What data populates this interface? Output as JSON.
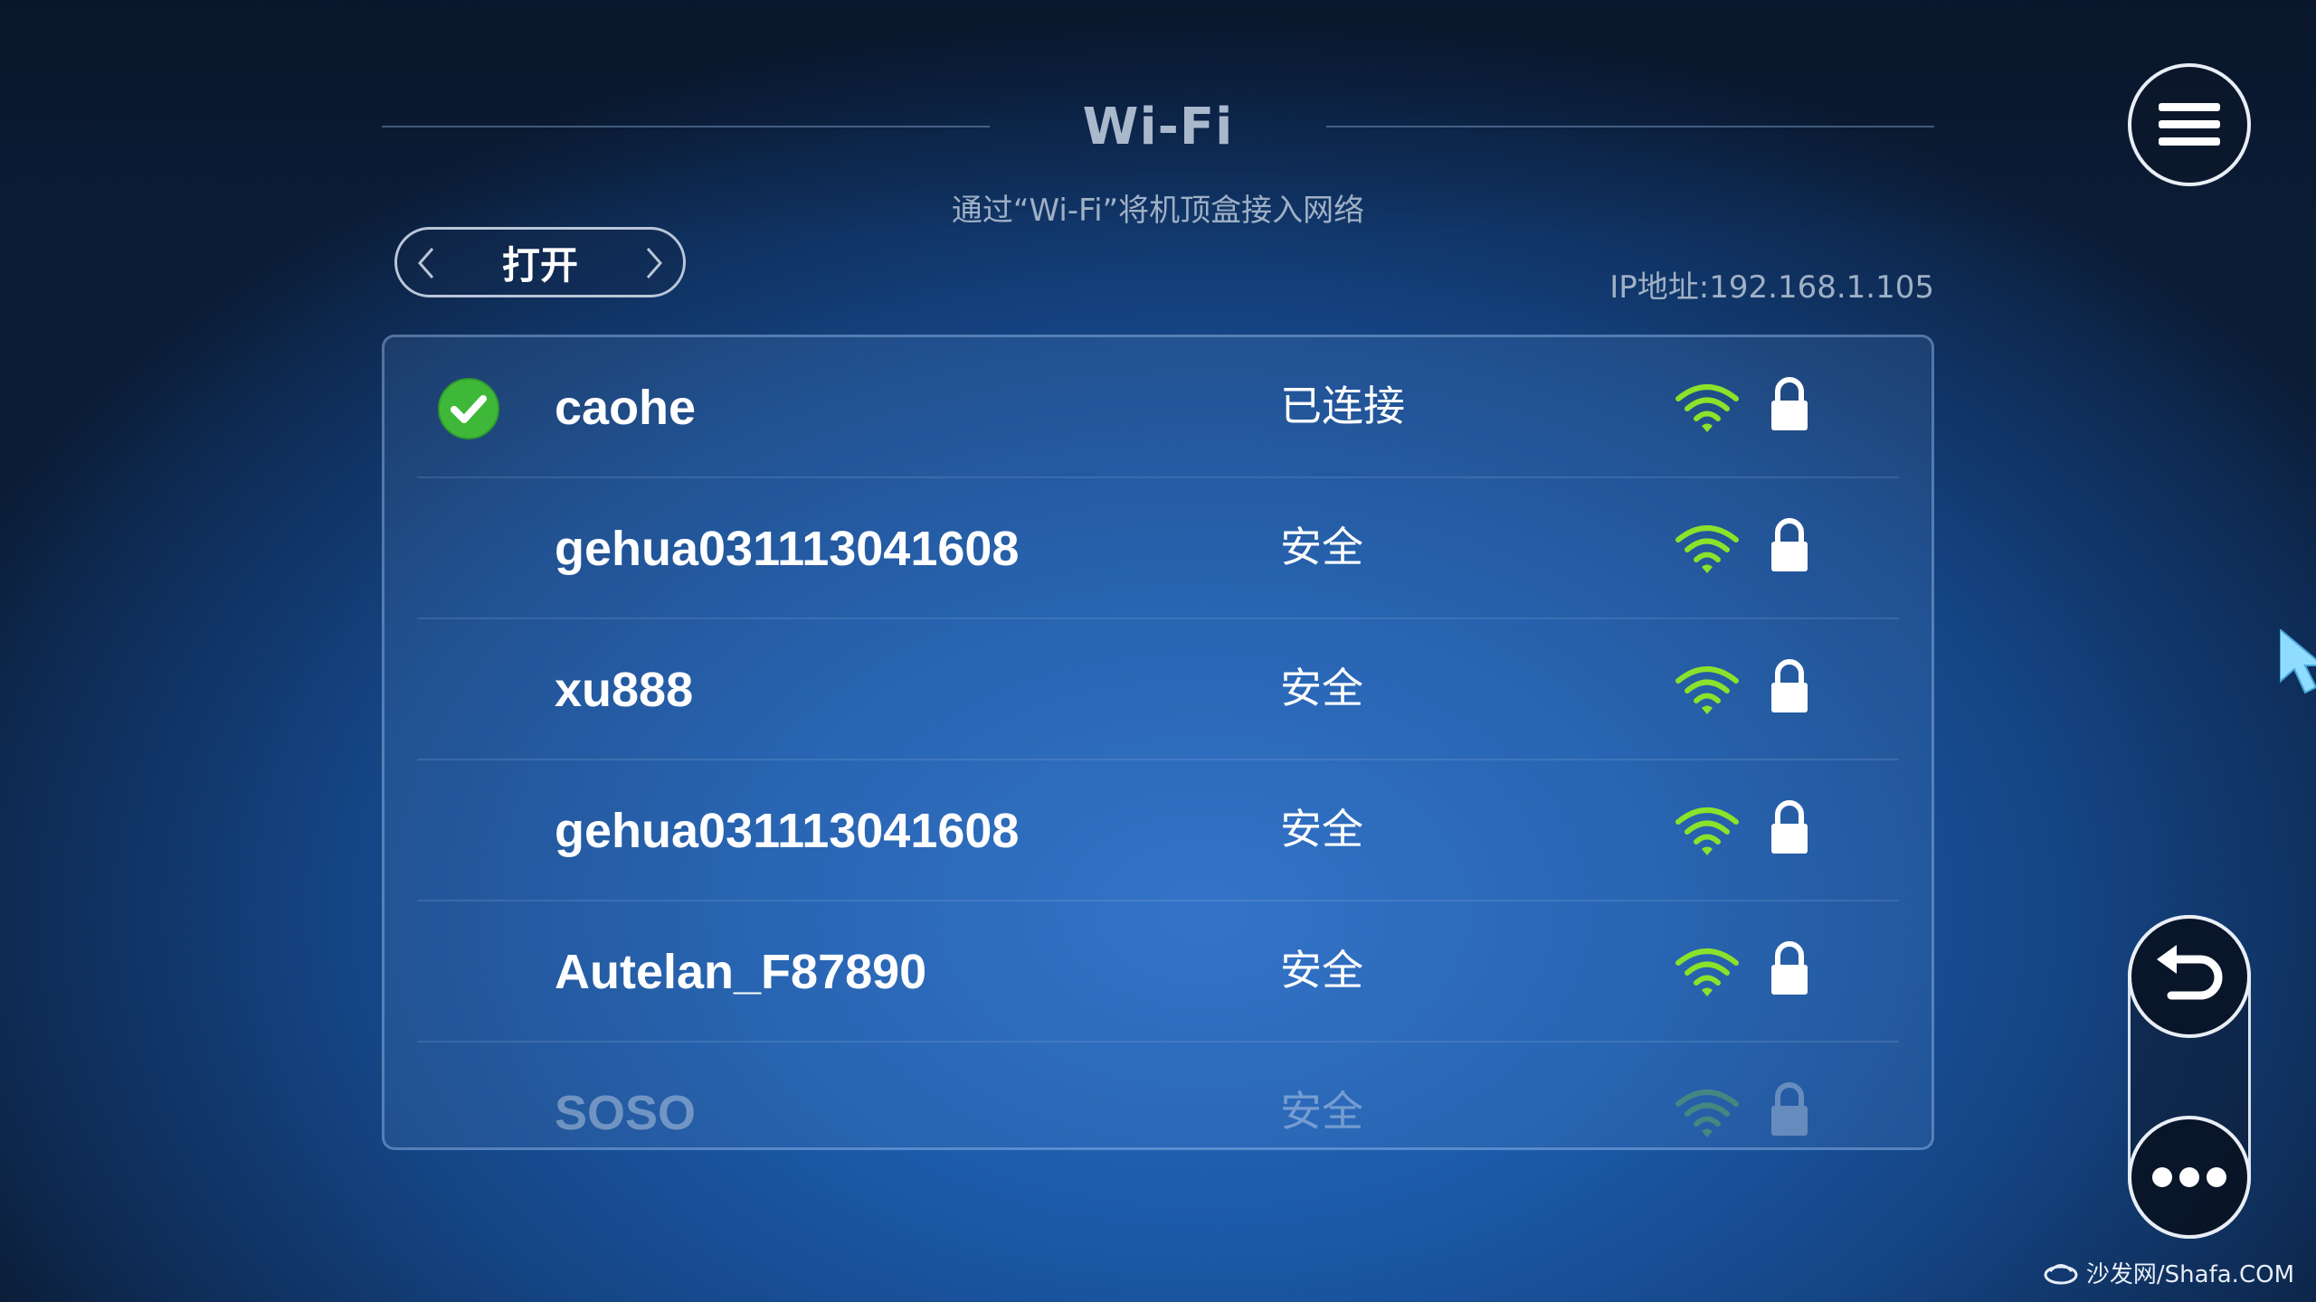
{
  "header": {
    "title": "Wi-Fi",
    "subtitle": "通过“Wi-Fi”将机顶盒接入网络"
  },
  "toggle": {
    "label": "打开",
    "prev_icon": "chevron-left-icon",
    "next_icon": "chevron-right-icon"
  },
  "ip_label": "IP地址:192.168.1.105",
  "networks": [
    {
      "ssid": "caohe",
      "status": "已连接",
      "connected": true,
      "secured": true
    },
    {
      "ssid": "gehua031113041608",
      "status": "安全",
      "connected": false,
      "secured": true
    },
    {
      "ssid": "xu888",
      "status": "安全",
      "connected": false,
      "secured": true
    },
    {
      "ssid": "gehua031113041608",
      "status": "安全",
      "connected": false,
      "secured": true
    },
    {
      "ssid": "Autelan_F87890",
      "status": "安全",
      "connected": false,
      "secured": true
    },
    {
      "ssid": "SOSO",
      "status": "安全",
      "connected": false,
      "secured": true
    }
  ],
  "controls": {
    "menu_icon": "hamburger-menu-icon",
    "back_icon": "undo-back-icon",
    "more_icon": "more-dots-icon"
  },
  "watermark": {
    "text": "沙发网/Shafa.COM"
  },
  "colors": {
    "signal_green": "#8be22a",
    "check_green": "#3fb83a",
    "background_blue": "#1c5aa9"
  }
}
